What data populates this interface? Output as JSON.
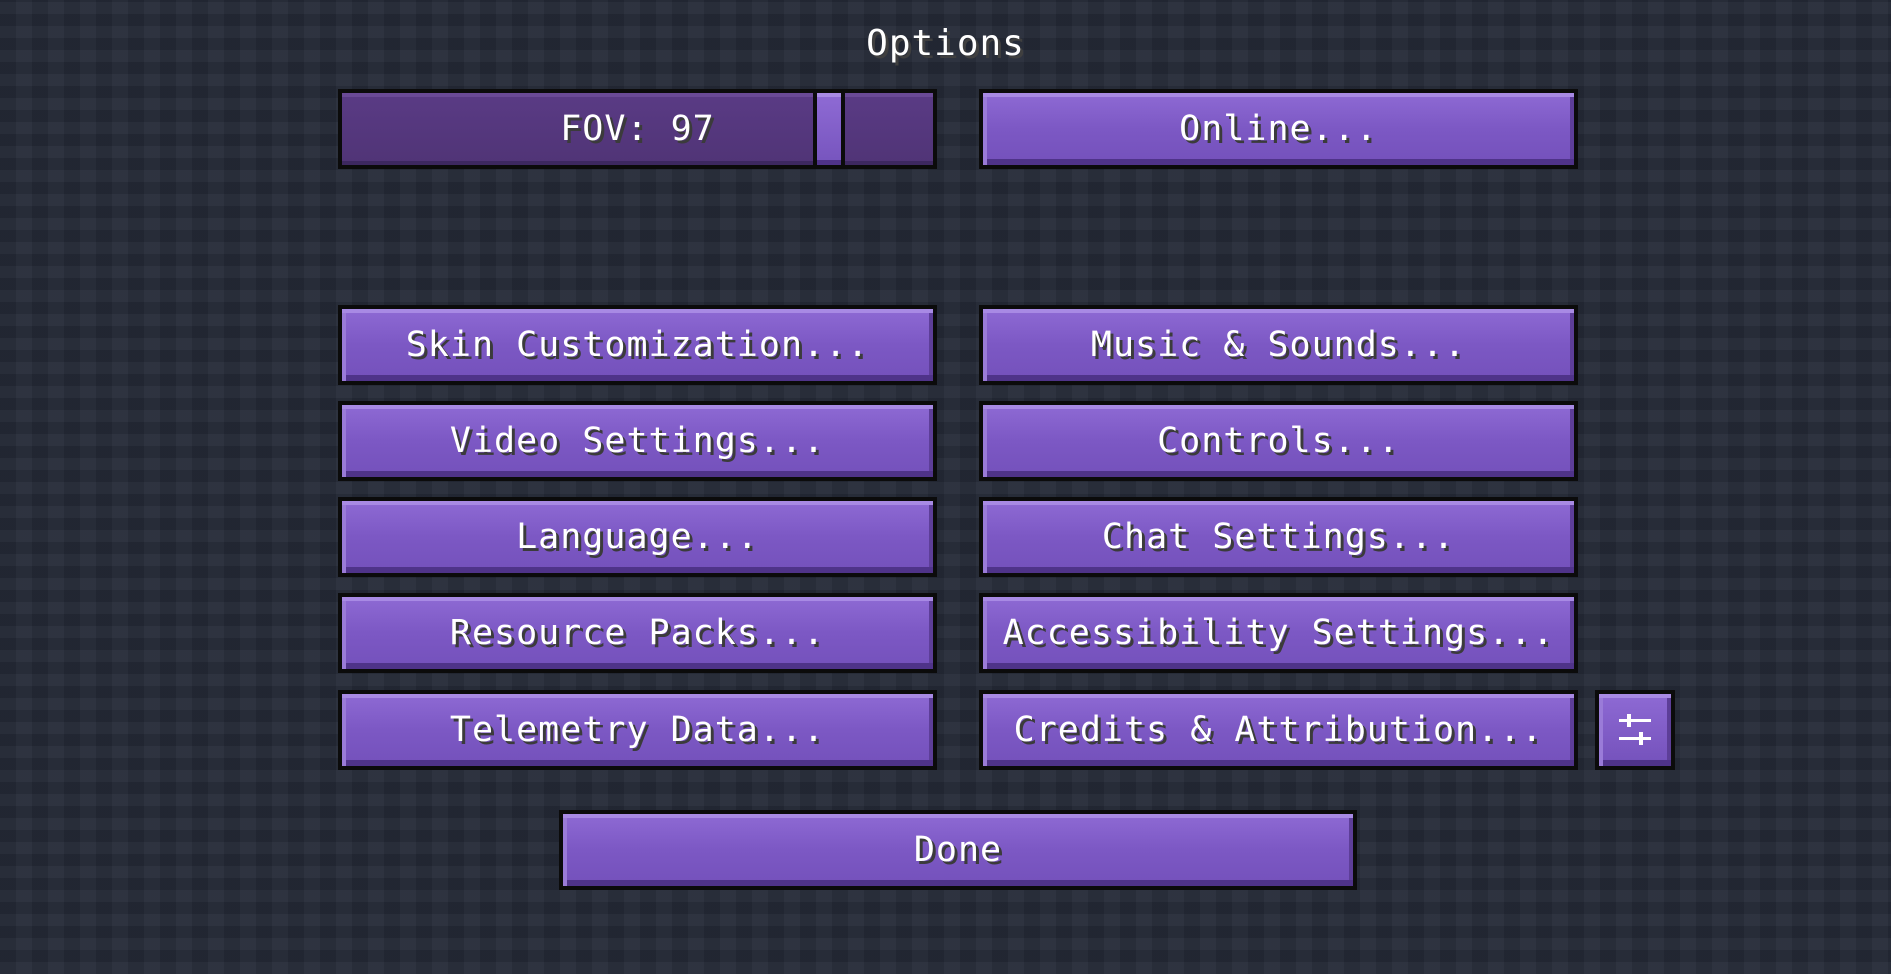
{
  "screen": {
    "title": "Options"
  },
  "fov_slider": {
    "label": "FOV: 97",
    "value": 97,
    "min": 30,
    "max": 110
  },
  "buttons": {
    "online": "Online...",
    "skin_customization": "Skin Customization...",
    "music_sounds": "Music & Sounds...",
    "video_settings": "Video Settings...",
    "controls": "Controls...",
    "language": "Language...",
    "chat_settings": "Chat Settings...",
    "resource_packs": "Resource Packs...",
    "accessibility_settings": "Accessibility Settings...",
    "telemetry_data": "Telemetry Data...",
    "credits_attribution": "Credits & Attribution...",
    "done": "Done"
  },
  "icons": {
    "options_toggle": "sliders-icon"
  },
  "colors": {
    "button_fill": "#7c58c4",
    "slider_fill": "#523579",
    "text": "#ffffff",
    "background": "#252a37"
  }
}
